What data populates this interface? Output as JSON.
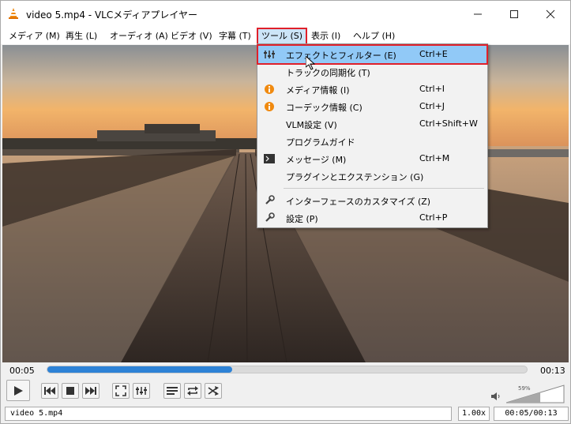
{
  "window": {
    "title": "video 5.mp4 - VLCメディアプレイヤー",
    "controls": {
      "minimize_icon": "minimize-icon",
      "maximize_icon": "maximize-icon",
      "close_icon": "close-icon"
    }
  },
  "menubar": {
    "items": [
      {
        "label": "メディア (M)"
      },
      {
        "label": "再生 (L)"
      },
      {
        "label": "オーディオ (A)"
      },
      {
        "label": "ビデオ (V)"
      },
      {
        "label": "字幕 (T)"
      },
      {
        "label": "ツール (S)"
      },
      {
        "label": "表示 (I)"
      },
      {
        "label": "ヘルプ (H)"
      }
    ],
    "active": "ツール (S)"
  },
  "tools_menu": {
    "items": [
      {
        "label": "エフェクトとフィルター (E)",
        "shortcut": "Ctrl+E",
        "icon": "equalizer-icon",
        "highlighted": true
      },
      {
        "label": "トラックの同期化 (T)",
        "shortcut": "",
        "icon": ""
      },
      {
        "label": "メディア情報 (I)",
        "shortcut": "Ctrl+I",
        "icon": "info-icon"
      },
      {
        "label": "コーデック情報 (C)",
        "shortcut": "Ctrl+J",
        "icon": "info-icon"
      },
      {
        "label": "VLM設定 (V)",
        "shortcut": "Ctrl+Shift+W",
        "icon": ""
      },
      {
        "label": "プログラムガイド",
        "shortcut": "",
        "icon": ""
      },
      {
        "label": "メッセージ (M)",
        "shortcut": "Ctrl+M",
        "icon": "terminal-icon"
      },
      {
        "label": "プラグインとエクステンション (G)",
        "shortcut": "",
        "icon": ""
      },
      {
        "label": "インターフェースのカスタマイズ (Z)",
        "shortcut": "",
        "icon": "wrench-icon"
      },
      {
        "label": "設定 (P)",
        "shortcut": "Ctrl+P",
        "icon": "wrench-icon"
      }
    ]
  },
  "playback": {
    "elapsed": "00:05",
    "total": "00:13",
    "progress_fraction": 0.385
  },
  "controls": {
    "buttons": [
      "play-icon",
      "previous-icon",
      "stop-icon",
      "next-icon",
      "fullscreen-icon",
      "extended-settings-icon",
      "playlist-icon",
      "loop-icon",
      "shuffle-icon"
    ]
  },
  "volume": {
    "percent_label": "59%",
    "level": 0.59
  },
  "status": {
    "filename": "video 5.mp4",
    "speed": "1.00x",
    "time": "00:05/00:13"
  },
  "colors": {
    "highlight_outline": "#e0202a",
    "menu_highlight": "#91c9f7",
    "seek_fill": "#2d82d6"
  }
}
